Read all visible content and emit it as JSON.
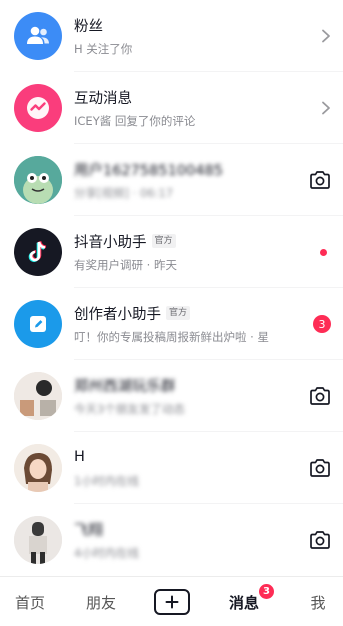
{
  "rows": [
    {
      "title": "粉丝",
      "subtitle": "H 关注了你",
      "avatar_icon": "people-icon",
      "avatar_color": "#3c8cf6",
      "right": "chevron-right-icon"
    },
    {
      "title": "互动消息",
      "subtitle": "ICEY酱 回复了你的评论",
      "avatar_icon": "wave-icon",
      "avatar_color": "#fa3d7c",
      "right": "chevron-right-icon"
    },
    {
      "title": "用户1627585100485",
      "subtitle": "分享[视频] · 06:17",
      "avatar_icon": "cartoon-frog-avatar",
      "blurred": true,
      "right": "camera-icon"
    },
    {
      "title": "抖音小助手",
      "tag": "官方",
      "subtitle": "有奖用户调研 · 昨天",
      "avatar_icon": "tiktok-note-icon",
      "avatar_color": "#161823",
      "right": "unread-dot"
    },
    {
      "title": "创作者小助手",
      "tag": "官方",
      "subtitle": "叮！你的专属投稿周报新鲜出炉啦 · 星",
      "avatar_icon": "edit-pencil-icon",
      "avatar_color": "#1b9aea",
      "right": "unread-count",
      "count": "3"
    },
    {
      "title": "郑州西湖玩乐群",
      "subtitle": "今天3个朋友发了动态",
      "avatar_icon": "group-photo-avatar",
      "blurred": true,
      "right": "camera-icon"
    },
    {
      "title": "H",
      "subtitle": "1小时内在线",
      "avatar_icon": "girl-photo-avatar",
      "subtitle_blurred": true,
      "right": "camera-icon"
    },
    {
      "title": "飞翔",
      "subtitle": "4小时内在线",
      "avatar_icon": "person-photo-avatar",
      "blurred": true,
      "right": "camera-icon"
    }
  ],
  "nav": {
    "home": "首页",
    "friends": "朋友",
    "plus_icon": "plus-icon",
    "messages": "消息",
    "messages_badge": "3",
    "me": "我"
  },
  "colors": {
    "accent": "#fe2c55",
    "text_primary": "#161823",
    "text_secondary": "#8a8b91"
  }
}
